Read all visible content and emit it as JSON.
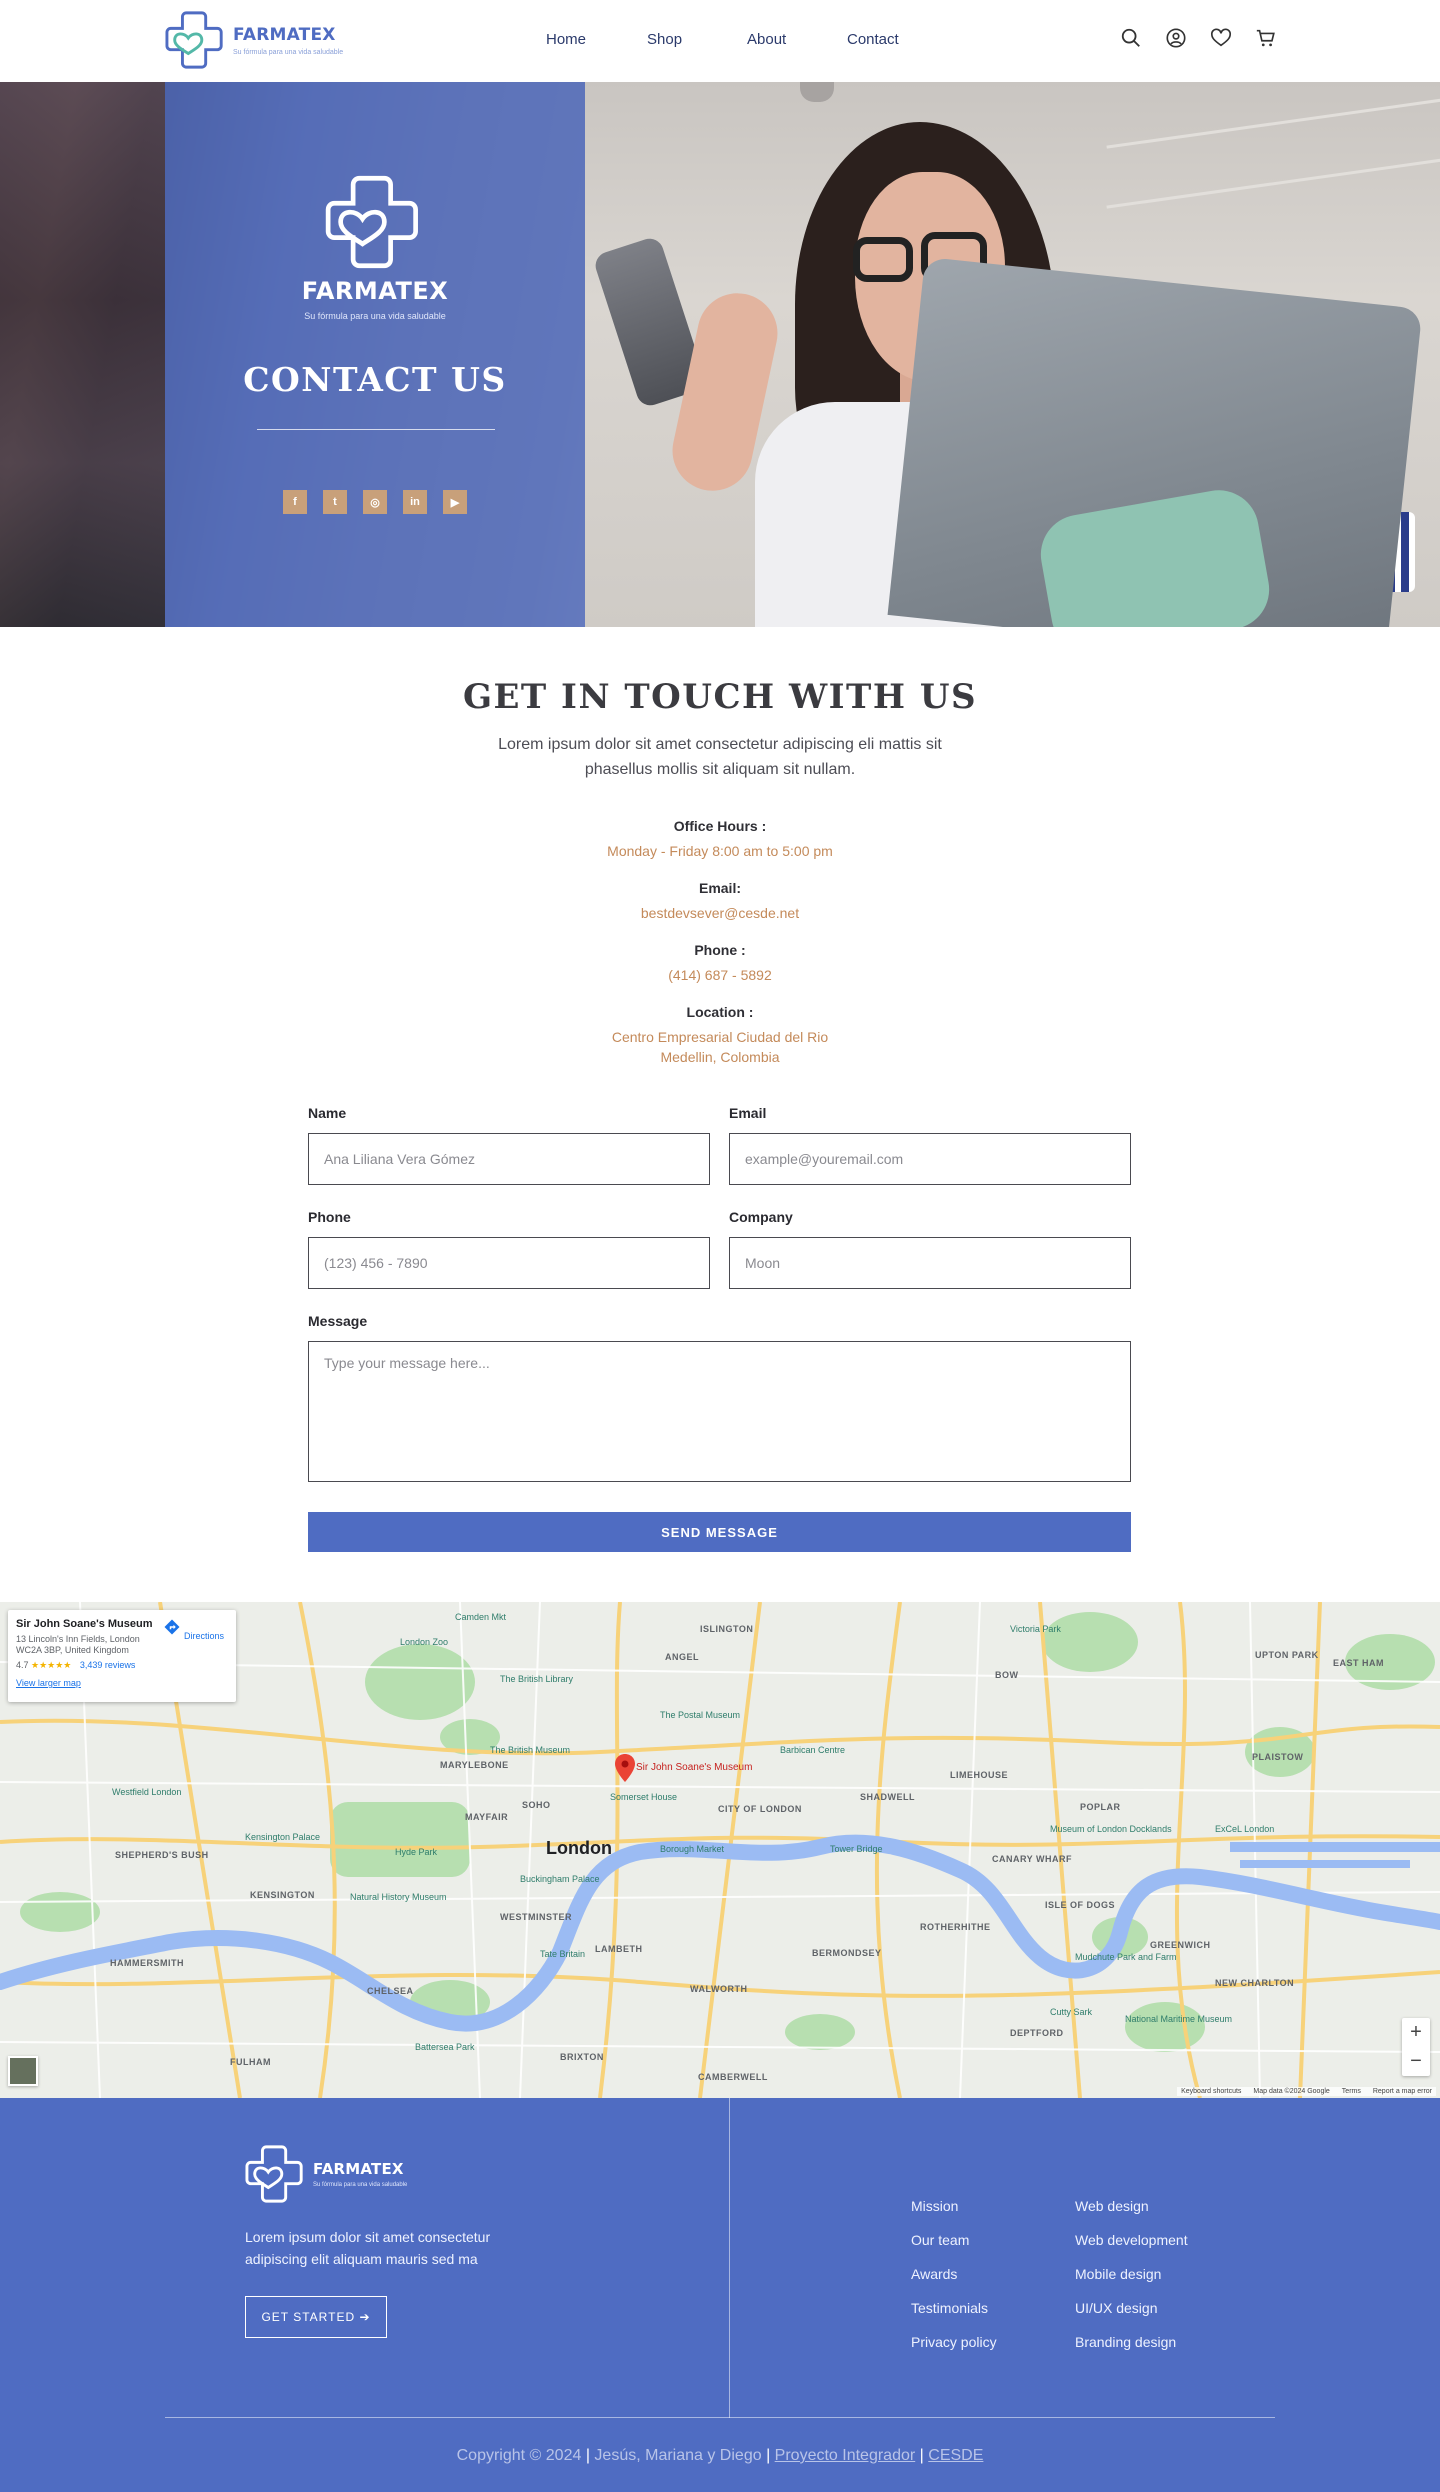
{
  "header": {
    "brand_name": "FARMATEX",
    "brand_tagline": "Su fórmula para una vida saludable",
    "nav": [
      {
        "label": "Home"
      },
      {
        "label": "Shop"
      },
      {
        "label": "About"
      },
      {
        "label": "Contact"
      }
    ],
    "icons": [
      "search-icon",
      "user-icon",
      "heart-icon",
      "cart-icon"
    ]
  },
  "hero": {
    "brand_name": "FARMATEX",
    "brand_tagline": "Su fórmula para una vida saludable",
    "title": "CONTACT US",
    "social": [
      {
        "icon": "facebook-icon",
        "glyph": "f"
      },
      {
        "icon": "twitter-icon",
        "glyph": "t"
      },
      {
        "icon": "instagram-icon",
        "glyph": "◎"
      },
      {
        "icon": "linkedin-icon",
        "glyph": "in"
      },
      {
        "icon": "youtube-icon",
        "glyph": "▶"
      }
    ]
  },
  "touch": {
    "title": "GET IN TOUCH WITH US",
    "subtitle": "Lorem ipsum dolor sit amet consectetur adipiscing eli mattis sit phasellus mollis sit aliquam sit nullam."
  },
  "info": {
    "hours_label": "Office Hours :",
    "hours_value": "Monday - Friday  8:00 am to 5:00 pm",
    "email_label": "Email:",
    "email_value": "bestdevsever@cesde.net",
    "phone_label": "Phone :",
    "phone_value": "(414) 687 - 5892",
    "location_label": "Location :",
    "location_line1": "Centro Empresarial Ciudad del Rio",
    "location_line2": "Medellin, Colombia"
  },
  "form": {
    "name_label": "Name",
    "name_placeholder": "Ana Liliana Vera Gómez",
    "email_label": "Email",
    "email_placeholder": "example@youremail.com",
    "phone_label": "Phone",
    "phone_placeholder": "(123) 456 - 7890",
    "company_label": "Company",
    "company_placeholder": "Moon",
    "message_label": "Message",
    "message_placeholder": "Type your message here...",
    "send_label": "SEND MESSAGE"
  },
  "map": {
    "place_name": "Sir John Soane's Museum",
    "place_address": "13 Lincoln's Inn Fields, London WC2A 3BP, United Kingdom",
    "rating": "4.7",
    "stars": "★★★★★",
    "reviews": "3,439 reviews",
    "larger_map": "View larger map",
    "directions": "Directions",
    "city": "London",
    "pin_label": "Sir John Soane's Museum",
    "zoom_in": "+",
    "zoom_out": "−",
    "attribution": [
      "Keyboard shortcuts",
      "Map data ©2024 Google",
      "Terms",
      "Report a map error"
    ],
    "districts": [
      "ISLINGTON",
      "ANGEL",
      "MARYLEBONE",
      "MAYFAIR",
      "SOHO",
      "CITY OF LONDON",
      "SHADWELL",
      "KENSINGTON",
      "WESTMINSTER",
      "LAMBETH",
      "BERMONDSEY",
      "ROTHERHITHE",
      "CANARY WHARF",
      "ISLE OF DOGS",
      "GREENWICH",
      "CHELSEA",
      "WALWORTH",
      "FULHAM",
      "HAMMERSMITH",
      "SHEPHERD'S BUSH",
      "LIMEHOUSE",
      "POPLAR",
      "BOW",
      "PLAISTOW",
      "UPTON PARK",
      "EAST HAM",
      "DEPTFORD",
      "NEW CHARLTON",
      "CAMBERWELL",
      "BRIXTON"
    ],
    "pois": [
      "The British Museum",
      "Somerset House",
      "Tower Bridge",
      "Borough Market",
      "Buckingham Palace",
      "Hyde Park",
      "Natural History Museum",
      "Barbican Centre",
      "The Postal Museum",
      "Camden Mkt",
      "London Zoo",
      "Victoria Park",
      "The British Library",
      "Tate Britain",
      "Battersea Park",
      "Mudchute Park and Farm",
      "Cutty Sark",
      "National Maritime Museum",
      "ExCeL London",
      "Museum of London Docklands",
      "Westfield London",
      "Kensington Palace"
    ]
  },
  "footer": {
    "brand_name": "FARMATEX",
    "brand_tagline": "Su fórmula para una vida saludable",
    "description": "Lorem ipsum dolor sit amet consectetur adipiscing elit aliquam mauris sed ma",
    "cta": "GET STARTED ➔",
    "col1": [
      "Mission",
      "Our team",
      "Awards",
      "Testimonials",
      "Privacy policy"
    ],
    "col2": [
      "Web design",
      "Web development",
      "Mobile design",
      "UI/UX design",
      "Branding design"
    ],
    "copyright": "Copyright © 2024",
    "authors": "Jesús, Mariana y Diego",
    "link1": "Proyecto Integrador",
    "link2": "CESDE",
    "separator": "|"
  },
  "colors": {
    "brand_blue": "#4f6cc2",
    "accent_tan": "#c48a5a",
    "heading": "#3b3b40"
  }
}
